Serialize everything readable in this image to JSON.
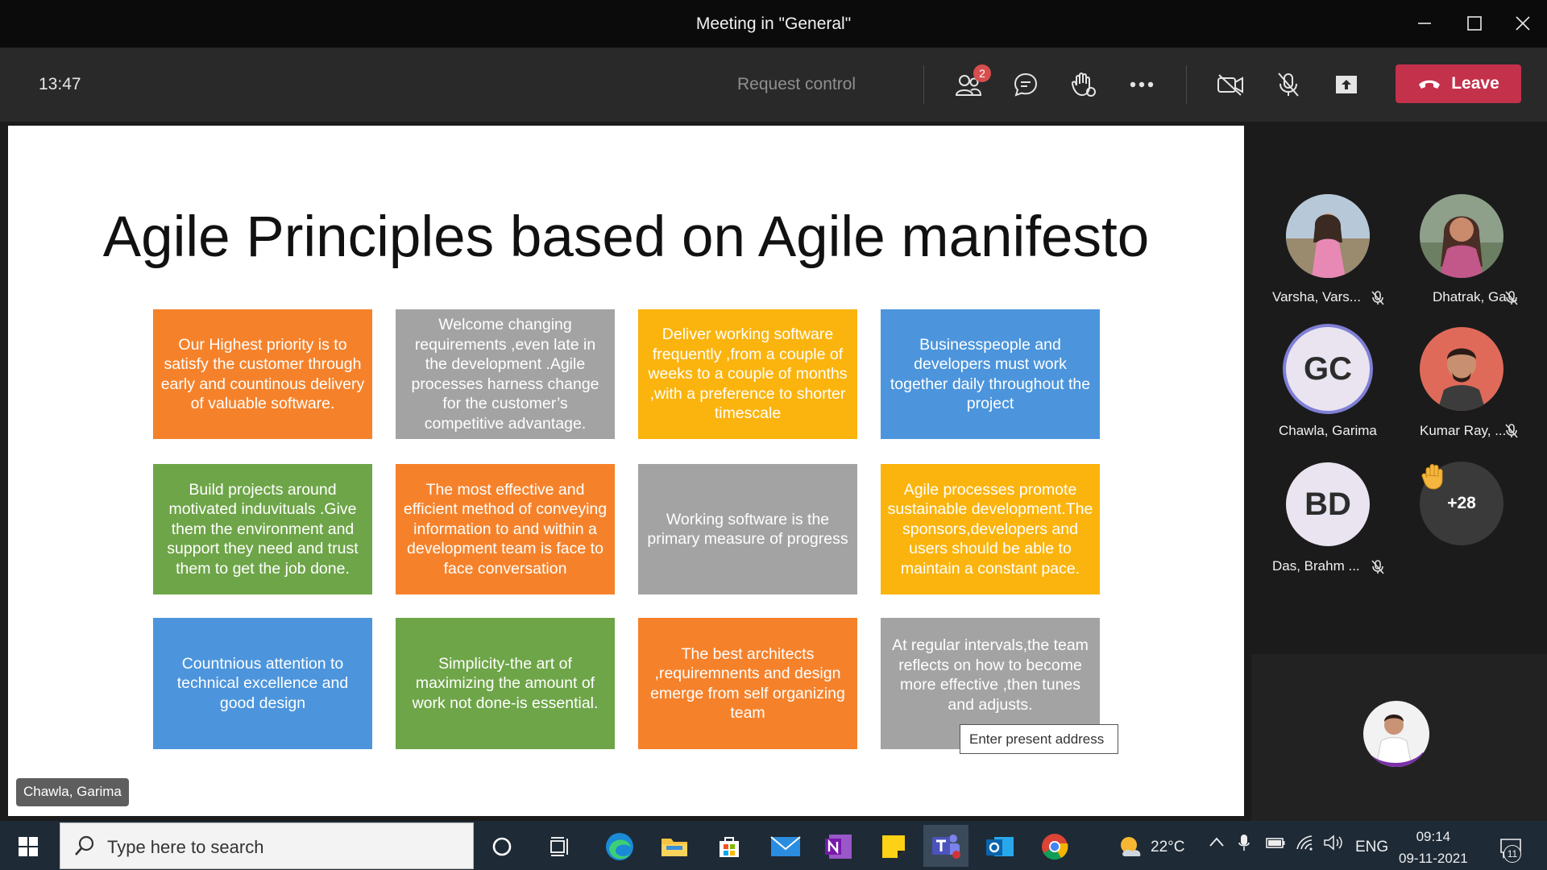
{
  "window": {
    "title": "Meeting in \"General\""
  },
  "toolbar": {
    "timer": "13:47",
    "request_control": "Request control",
    "people_badge": "2",
    "leave_label": "Leave"
  },
  "slide": {
    "title": "Agile Principles based on Agile manifesto",
    "cards": [
      {
        "text": "Our Highest priority is to satisfy the customer through early and countinous delivery of valuable software.",
        "color": "#f5822b"
      },
      {
        "text": "Welcome changing requirements ,even late in the development .Agile processes harness change for the customer’s competitive advantage.",
        "color": "#a4a3a4"
      },
      {
        "text": "Deliver working software frequently ,from a couple of weeks to a couple of months ,with a preference to shorter timescale",
        "color": "#fbb40d"
      },
      {
        "text": "Businesspeople and developers must work together daily throughout the project",
        "color": "#4c95dc"
      },
      {
        "text": "Build projects around motivated induvituals .Give them the environment and support they need and trust them to get the job done.",
        "color": "#6ea548"
      },
      {
        "text": "The most effective and efficient method of conveying information to and within a development team is face to face conversation",
        "color": "#f5822b"
      },
      {
        "text": "Working software is the primary measure of progress",
        "color": "#a4a3a4"
      },
      {
        "text": "Agile processes promote sustainable development.The sponsors,developers and users should be able to maintain a constant pace.",
        "color": "#fbb40d"
      },
      {
        "text": "Countnious attention to technical excellence and good design",
        "color": "#4c95dc"
      },
      {
        "text": "Simplicity-the art of maximizing the amount of work not done-is essential.",
        "color": "#6ea548"
      },
      {
        "text": "The best architects ,requiremnents  and design emerge from self organizing team",
        "color": "#f5822b"
      },
      {
        "text": "At regular intervals,the team reflects on how to become more effective ,then tunes and adjusts.",
        "color": "#a4a3a4"
      }
    ],
    "tooltip": "Enter present address",
    "presenter_name": "Chawla, Garima"
  },
  "participants": [
    {
      "name": "Varsha, Vars...",
      "muted": true
    },
    {
      "name": "Dhatrak, Ga...",
      "muted": true
    },
    {
      "name": "Chawla, Garima",
      "initials": "GC",
      "muted": false
    },
    {
      "name": "Kumar Ray, ...",
      "muted": true
    },
    {
      "name": "Das, Brahm ...",
      "initials": "BD",
      "muted": true
    }
  ],
  "overflow": {
    "count": "+28"
  },
  "taskbar": {
    "search_placeholder": "Type here to search",
    "weather": "22°C",
    "lang": "ENG",
    "time": "09:14",
    "date": "09-11-2021",
    "notifications": "11"
  }
}
